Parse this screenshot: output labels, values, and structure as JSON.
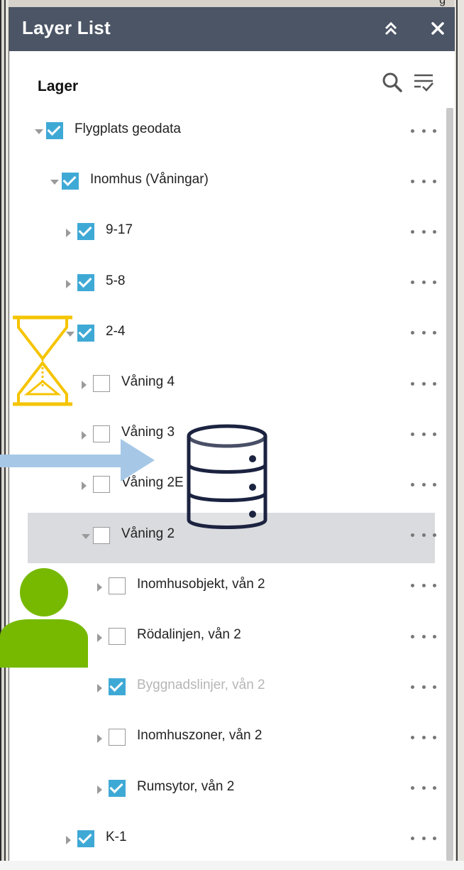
{
  "panel": {
    "title": "Layer List",
    "heading": "Lager"
  },
  "icons": {
    "collapse": "chevrons-up-icon",
    "close": "close-icon",
    "search": "search-icon",
    "filter": "filter-list-icon",
    "more": "more-dots-icon"
  },
  "colors": {
    "header_bg": "#4b5566",
    "checkbox_checked": "#3fa9d6",
    "selected_row": "#d9dbde",
    "hourglass": "#f5c400",
    "database": "#1b2340",
    "arrow": "#a6c8e6",
    "person": "#76b900"
  },
  "layers": [
    {
      "label": "Flygplats geodata",
      "checked": true,
      "expander": "down"
    },
    {
      "label": "Inomhus (Våningar)",
      "checked": true,
      "expander": "down"
    },
    {
      "label": "9-17",
      "checked": true,
      "expander": "right"
    },
    {
      "label": "5-8",
      "checked": true,
      "expander": "right"
    },
    {
      "label": "2-4",
      "checked": true,
      "expander": "down"
    },
    {
      "label": "Våning 4",
      "checked": false,
      "expander": "right"
    },
    {
      "label": "Våning 3",
      "checked": false,
      "expander": "right"
    },
    {
      "label": "Våning 2E",
      "checked": false,
      "expander": "right"
    },
    {
      "label": "Våning 2",
      "checked": false,
      "expander": "down",
      "selected": true
    },
    {
      "label": "Inomhusobjekt, vån 2",
      "checked": false,
      "expander": "right"
    },
    {
      "label": "Rödalinjen, vån 2",
      "checked": false,
      "expander": "right"
    },
    {
      "label": "Byggnadslinjer, vån 2",
      "checked": true,
      "expander": "right",
      "dim": true
    },
    {
      "label": "Inomhuszoner, vån 2",
      "checked": false,
      "expander": "right"
    },
    {
      "label": "Rumsytor, vån 2",
      "checked": true,
      "expander": "right"
    },
    {
      "label": "K-1",
      "checked": true,
      "expander": "right"
    }
  ]
}
